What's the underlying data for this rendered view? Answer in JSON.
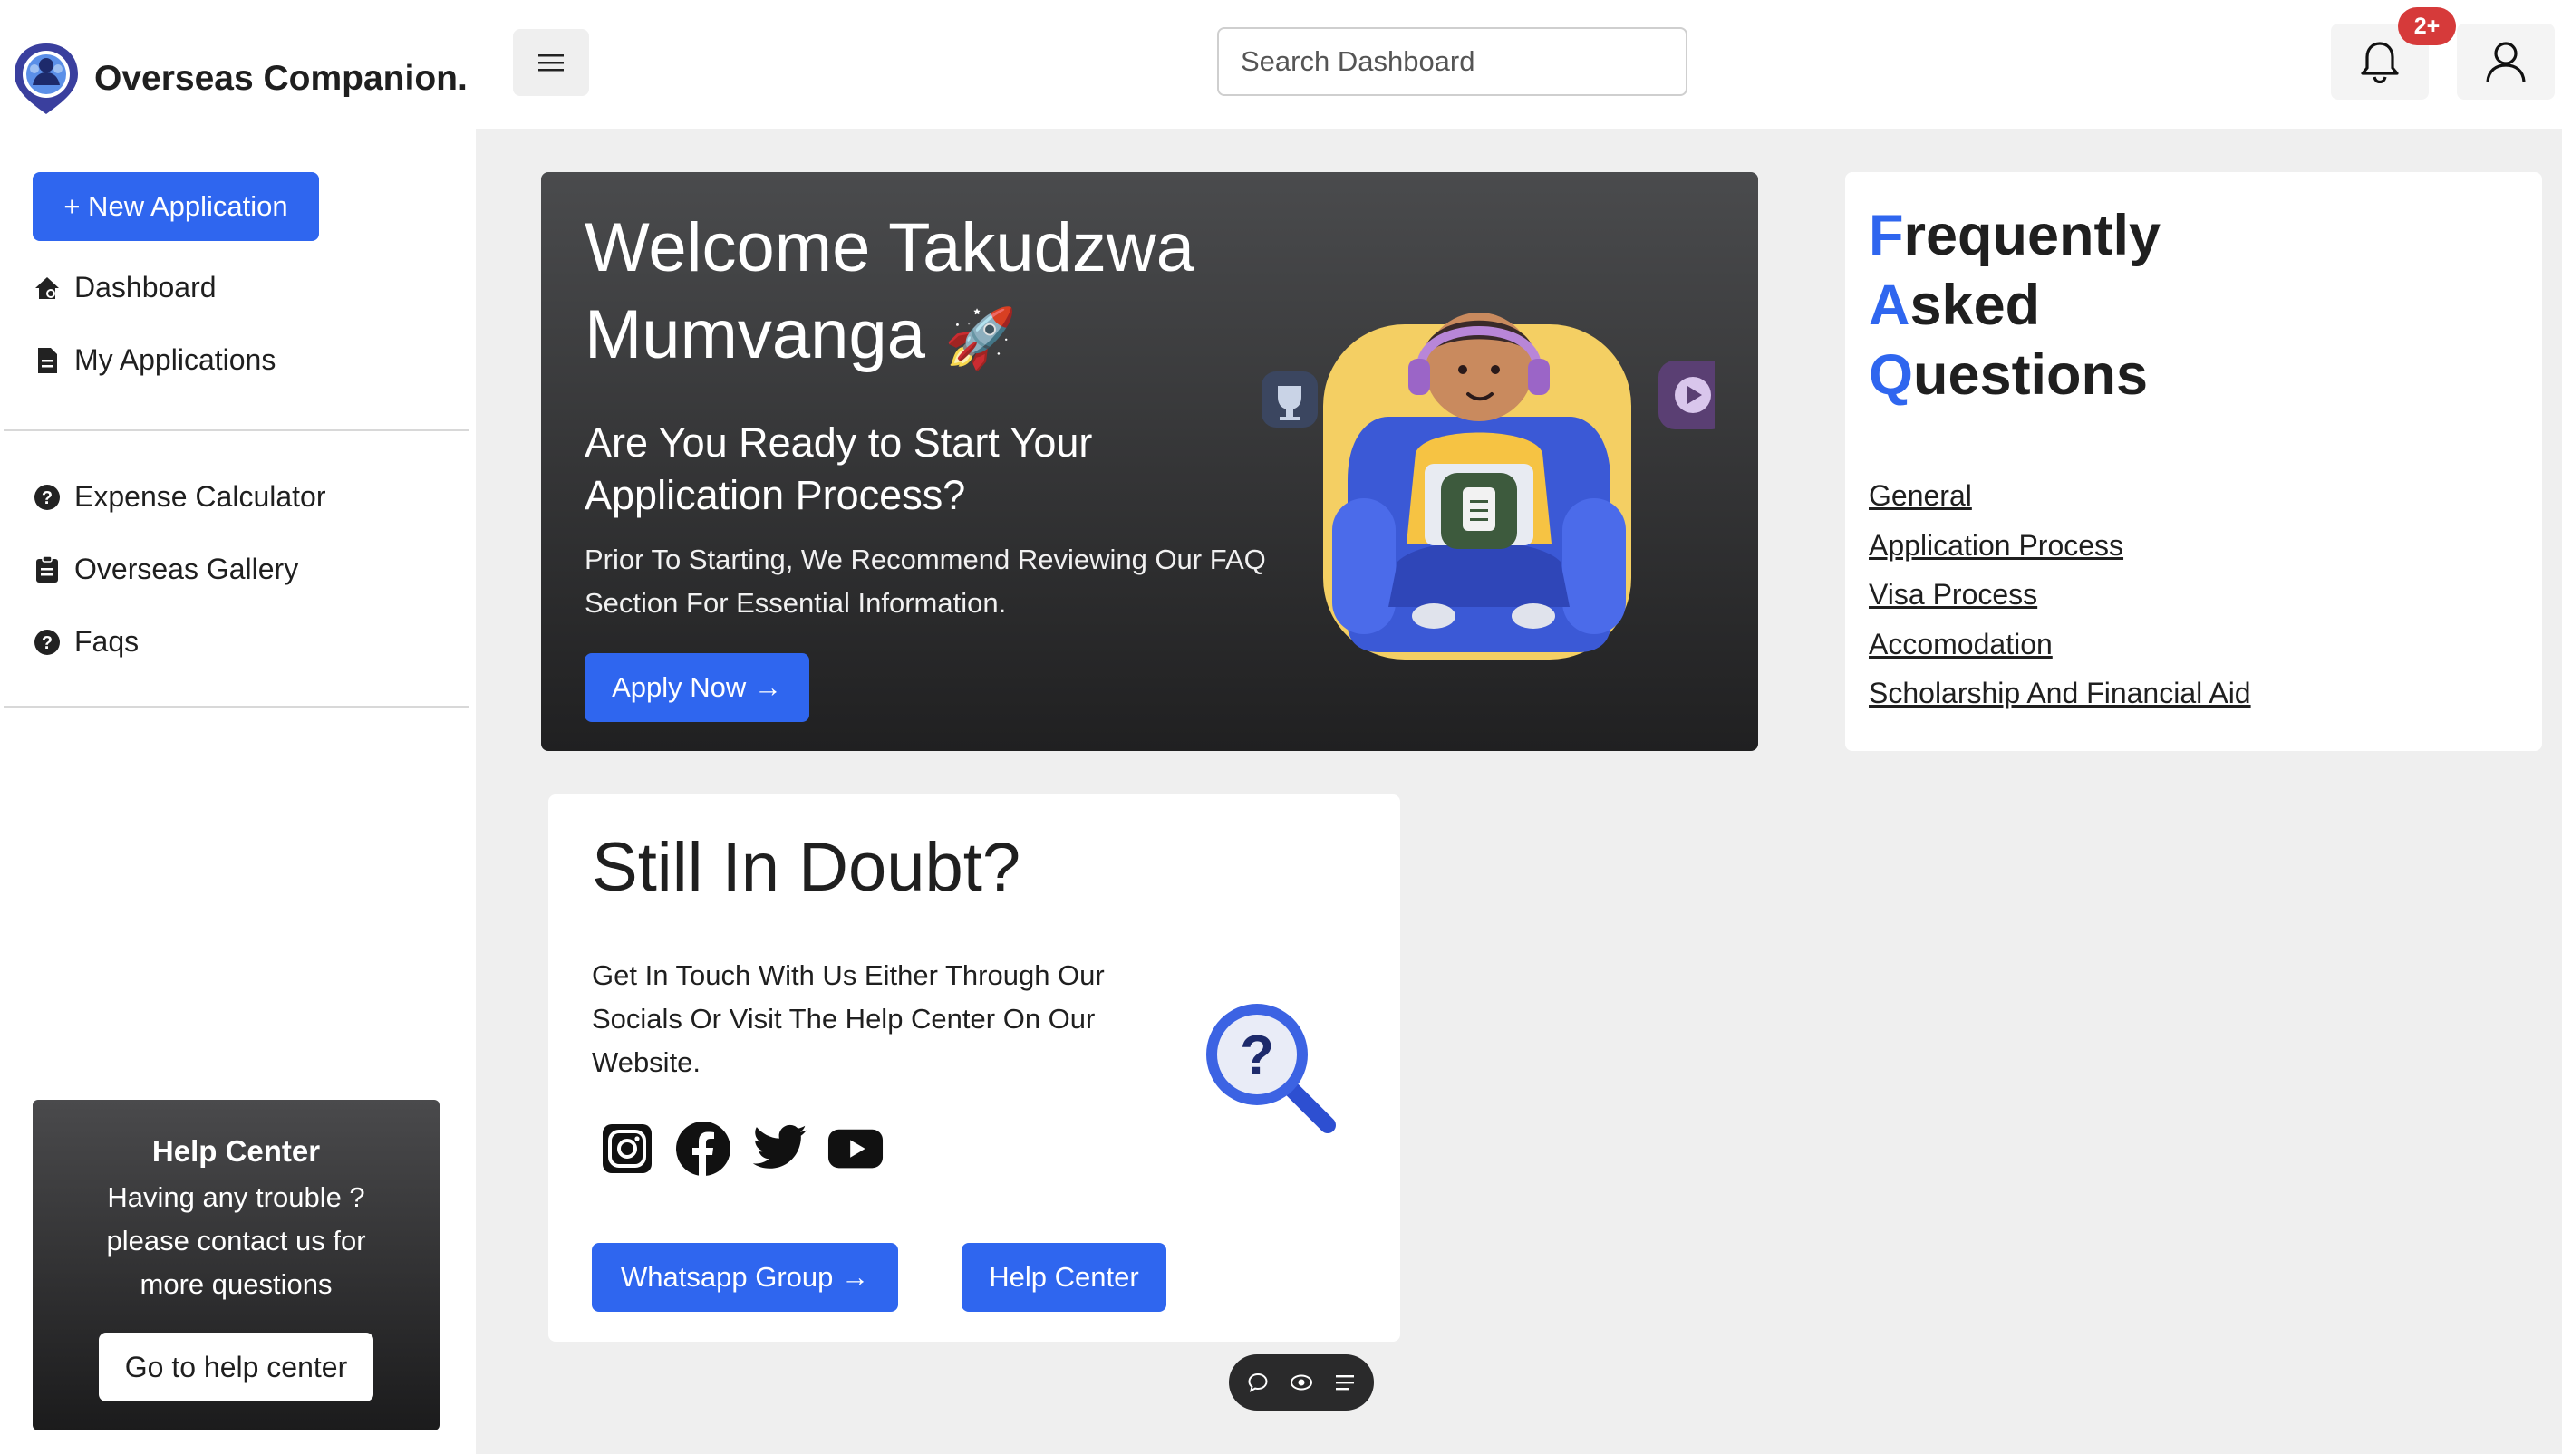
{
  "brand": {
    "name": "Overseas Companion."
  },
  "header": {
    "search_placeholder": "Search Dashboard",
    "notification_badge": "2+"
  },
  "sidebar": {
    "new_application_label": "+ New Application",
    "primary_items": [
      {
        "label": "Dashboard",
        "icon": "home-icon"
      },
      {
        "label": "My Applications",
        "icon": "document-icon"
      }
    ],
    "secondary_items": [
      {
        "label": "Expense Calculator",
        "icon": "question-circle-icon"
      },
      {
        "label": "Overseas Gallery",
        "icon": "clipboard-icon"
      },
      {
        "label": "Faqs",
        "icon": "question-circle-icon"
      }
    ],
    "help_card": {
      "title": "Help Center",
      "text": "Having any trouble ? please contact us for more questions",
      "button_label": "Go to help center"
    }
  },
  "welcome": {
    "title_line1": "Welcome Takudzwa",
    "title_line2": "Mumvanga",
    "emoji": "🚀",
    "subtitle": "Are You Ready to Start Your Application Process?",
    "description": "Prior To Starting, We Recommend Reviewing Our FAQ Section For Essential Information.",
    "apply_label": "Apply Now →"
  },
  "faq": {
    "heading": [
      {
        "first": "F",
        "rest": "requently"
      },
      {
        "first": "A",
        "rest": "sked"
      },
      {
        "first": "Q",
        "rest": "uestions"
      }
    ],
    "links": [
      "General",
      "Application Process",
      "Visa Process",
      "Accomodation",
      "Scholarship And Financial Aid"
    ]
  },
  "doubt": {
    "title": "Still In Doubt?",
    "text": "Get In Touch With Us Either Through Our Socials Or Visit The Help Center On Our Website.",
    "socials": [
      "instagram-icon",
      "facebook-icon",
      "twitter-icon",
      "youtube-icon"
    ],
    "whatsapp_label": "Whatsapp Group →",
    "help_center_label": "Help Center"
  },
  "colors": {
    "accent": "#2f66ef",
    "badge": "#d63a3a",
    "background": "#efefef",
    "dark_card": "#2b2b2c"
  }
}
